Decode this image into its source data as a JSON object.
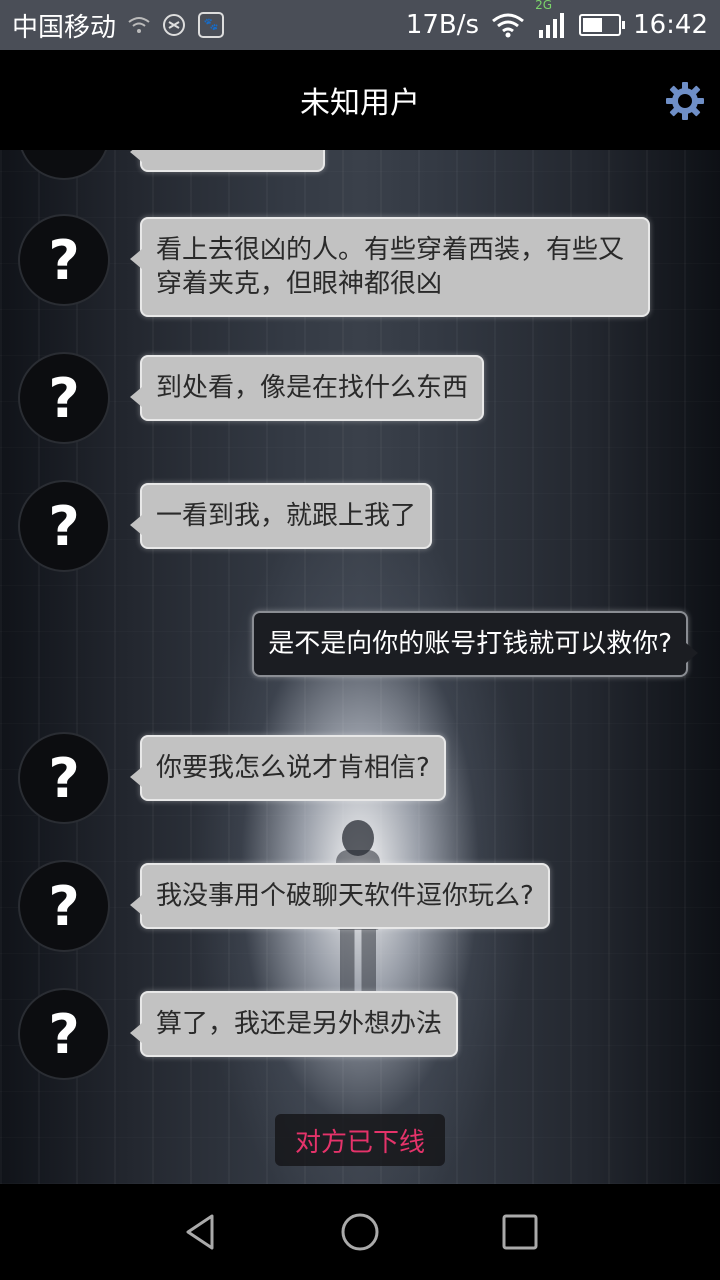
{
  "status_bar": {
    "carrier": "中国移动",
    "net_speed": "17B/s",
    "network_type": "2G",
    "time": "16:42",
    "battery_level": 0.55,
    "app_chip_glyph": "🐾"
  },
  "header": {
    "title": "未知用户"
  },
  "messages": [
    {
      "from": "other",
      "avatar": "?",
      "text": "看上去很凶的人。有些穿着西装，有些又穿着夹克，但眼神都很凶"
    },
    {
      "from": "other",
      "avatar": "?",
      "text": "到处看，像是在找什么东西"
    },
    {
      "from": "other",
      "avatar": "?",
      "text": "一看到我，就跟上我了"
    },
    {
      "from": "me",
      "text": "是不是向你的账号打钱就可以救你?"
    },
    {
      "from": "other",
      "avatar": "?",
      "text": "你要我怎么说才肯相信?"
    },
    {
      "from": "other",
      "avatar": "?",
      "text": "我没事用个破聊天软件逗你玩么?"
    },
    {
      "from": "other",
      "avatar": "?",
      "text": "算了，我还是另外想办法"
    }
  ],
  "offline_notice": "对方已下线",
  "colors": {
    "offline_text": "#e5336a",
    "incoming_bubble": "#c2c2c2",
    "outgoing_bubble": "#1b1d22"
  },
  "icons": {
    "settings": "gear-icon",
    "back": "back-triangle-icon",
    "home": "home-circle-icon",
    "recents": "recents-square-icon"
  }
}
